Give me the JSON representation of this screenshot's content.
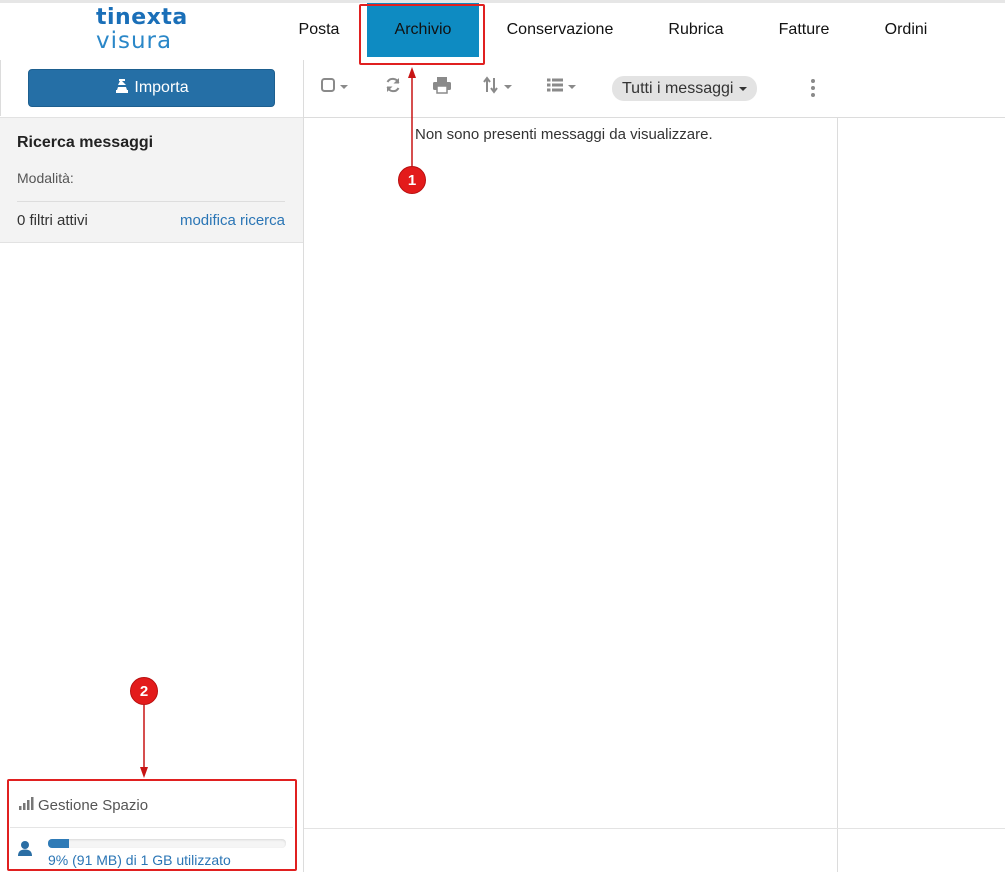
{
  "app": {
    "logo_top": "tinexta",
    "logo_bottom": "visura"
  },
  "nav": {
    "items": [
      {
        "label": "Posta",
        "active": false
      },
      {
        "label": "Archivio",
        "active": true
      },
      {
        "label": "Conservazione",
        "active": false
      },
      {
        "label": "Rubrica",
        "active": false
      },
      {
        "label": "Fatture",
        "active": false
      },
      {
        "label": "Ordini",
        "active": false
      }
    ]
  },
  "sidebar": {
    "import_label": "Importa",
    "search": {
      "title": "Ricerca messaggi",
      "mode_label": "Modalità:",
      "filters_label": "0 filtri attivi",
      "edit_link": "modifica ricerca"
    },
    "space": {
      "title": "Gestione Spazio",
      "usage_text": "9% (91 MB) di 1 GB utilizzato",
      "usage_fraction": 0.09
    }
  },
  "toolbar": {
    "icons": [
      "checkbox-icon",
      "refresh-icon",
      "print-icon",
      "sort-icon",
      "list-view-icon",
      "more-icon"
    ],
    "filter_label": "Tutti i messaggi"
  },
  "message_list": {
    "empty_text": "Non sono presenti messaggi da visualizzare."
  },
  "annotations": {
    "callouts": [
      "1",
      "2"
    ],
    "color": "#e31b1b"
  },
  "colors": {
    "accent": "#0e8bc2",
    "button": "#256fa6",
    "link": "#2a75b5"
  }
}
